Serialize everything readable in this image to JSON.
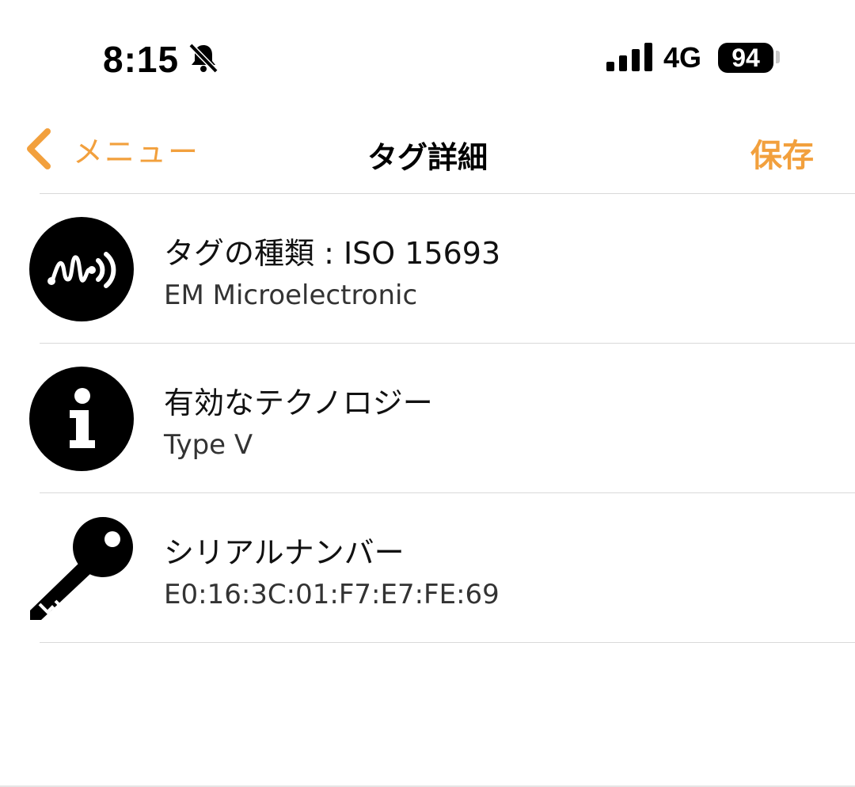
{
  "status_bar": {
    "time": "8:15",
    "network": "4G",
    "battery": "94"
  },
  "nav": {
    "back_label": "メニュー",
    "title": "タグ詳細",
    "save_label": "保存"
  },
  "rows": [
    {
      "title": "タグの種類 : ISO 15693",
      "subtitle": "EM Microelectronic",
      "icon": "nfc-wave-icon"
    },
    {
      "title": "有効なテクノロジー",
      "subtitle": "Type V",
      "icon": "info-icon"
    },
    {
      "title": "シリアルナンバー",
      "subtitle": "E0:16:3C:01:F7:E7:FE:69",
      "icon": "key-icon"
    }
  ],
  "colors": {
    "accent": "#F2A03D",
    "divider": "#d9d9d9"
  }
}
